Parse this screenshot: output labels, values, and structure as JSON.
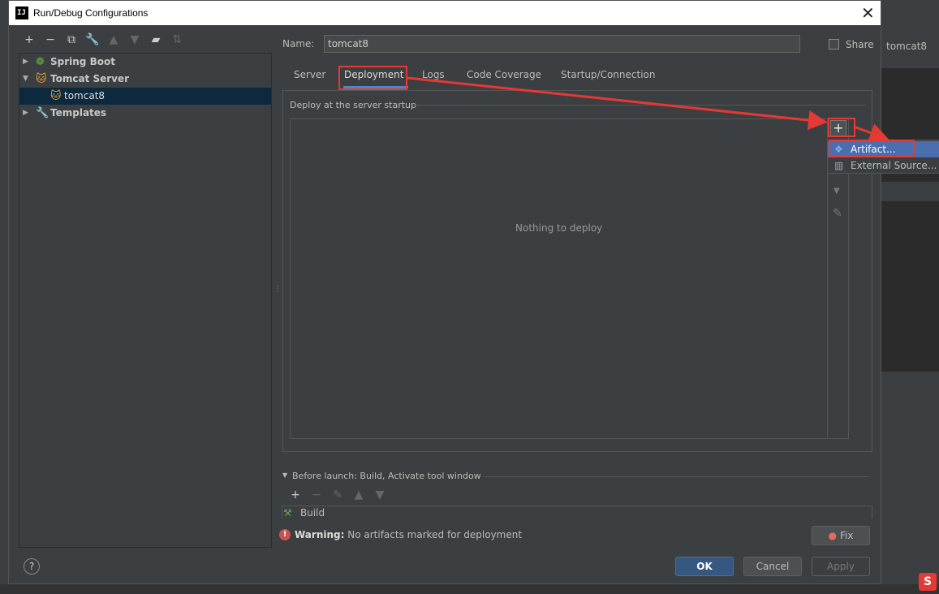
{
  "window": {
    "title": "Run/Debug Configurations",
    "logo_text": "IJ",
    "close_glyph": "✕"
  },
  "background": {
    "right_tab_label": "tomcat8"
  },
  "left_toolbar": {
    "icons": [
      "add-icon",
      "remove-icon",
      "copy-icon",
      "wrench-icon",
      "move-up-icon",
      "move-down-icon",
      "folder-icon",
      "sort-icon"
    ]
  },
  "tree": {
    "items": [
      {
        "label": "Spring Boot",
        "icon": "spring-boot-icon",
        "arrow": "▶"
      },
      {
        "label": "Tomcat Server",
        "icon": "tomcat-icon",
        "arrow": "▼"
      },
      {
        "label": "tomcat8",
        "icon": "tomcat-icon",
        "arrow": ""
      },
      {
        "label": "Templates",
        "icon": "wrench-icon",
        "arrow": "▶"
      }
    ]
  },
  "form": {
    "name_label": "Name:",
    "name_value": "tomcat8",
    "share_label": "Share",
    "share_checked": false
  },
  "tabs": [
    {
      "label": "Server",
      "active": false
    },
    {
      "label": "Deployment",
      "active": true
    },
    {
      "label": "Logs",
      "active": false
    },
    {
      "label": "Code Coverage",
      "active": false
    },
    {
      "label": "Startup/Connection",
      "active": false
    }
  ],
  "deployment": {
    "section_title": "Deploy at the server startup",
    "empty_text": "Nothing to deploy"
  },
  "popup": {
    "items": [
      {
        "label": "Artifact...",
        "icon": "artifact-icon",
        "highlighted": true
      },
      {
        "label": "External Source...",
        "icon": "external-source-icon",
        "highlighted": false
      }
    ]
  },
  "before_launch": {
    "title": "Before launch: Build, Activate tool window",
    "tasks": [
      {
        "label": "Build",
        "icon": "hammer-icon"
      }
    ]
  },
  "warning": {
    "prefix": "Warning:",
    "message": "No artifacts marked for deployment",
    "fix_label": "Fix"
  },
  "buttons": {
    "help": "?",
    "ok": "OK",
    "cancel": "Cancel",
    "apply": "Apply"
  },
  "watermark": {
    "text": "S"
  },
  "colors": {
    "accent_blue": "#4b6eaf",
    "selection": "#0d293e",
    "annotation_red": "#e53935",
    "ok_button": "#365880"
  }
}
